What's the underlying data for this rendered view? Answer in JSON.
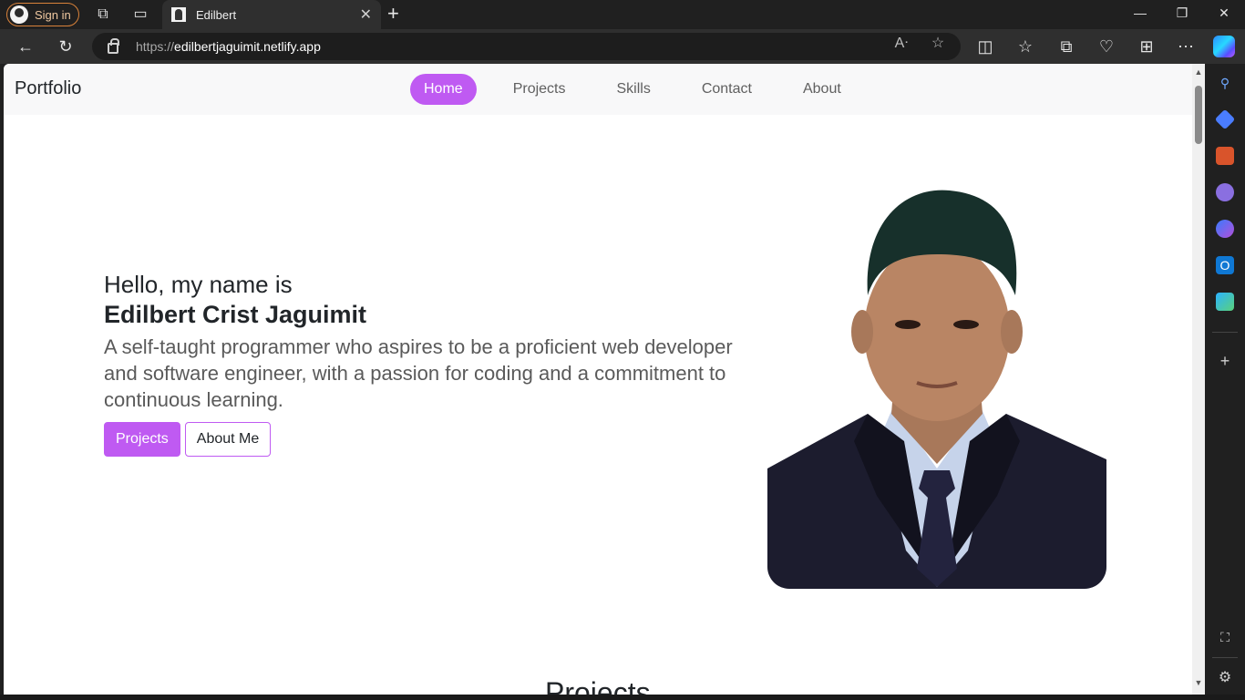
{
  "browser": {
    "signin_label": "Sign in",
    "tab_title": "Edilbert",
    "url_scheme": "https://",
    "url_host": "edilbertjaguimit.netlify.app"
  },
  "site": {
    "brand": "Portfolio",
    "nav": [
      "Home",
      "Projects",
      "Skills",
      "Contact",
      "About"
    ],
    "active_nav": "Home",
    "accent_color": "#bf5af2"
  },
  "hero": {
    "greeting": "Hello, my name is",
    "name": "Edilbert Crist Jaguimit",
    "description": "A self-taught programmer who aspires to be a proficient web developer and software engineer, with a passion for coding and a commitment to continuous learning.",
    "primary_button": "Projects",
    "secondary_button": "About Me"
  },
  "next_section": {
    "title": "Projects"
  },
  "icons": [
    "workspaces-icon",
    "tab-actions-icon",
    "back-icon",
    "refresh-icon",
    "lock-icon",
    "read-aloud-icon",
    "favorite-icon",
    "split-screen-icon",
    "favorites-icon",
    "collections-icon",
    "performance-icon",
    "extensions-icon",
    "more-icon",
    "copilot-icon",
    "search-icon",
    "shopping-icon",
    "tools-icon",
    "games-icon",
    "microsoft365-icon",
    "outlook-icon",
    "drop-icon",
    "add-icon",
    "screenshot-icon",
    "settings-icon"
  ]
}
